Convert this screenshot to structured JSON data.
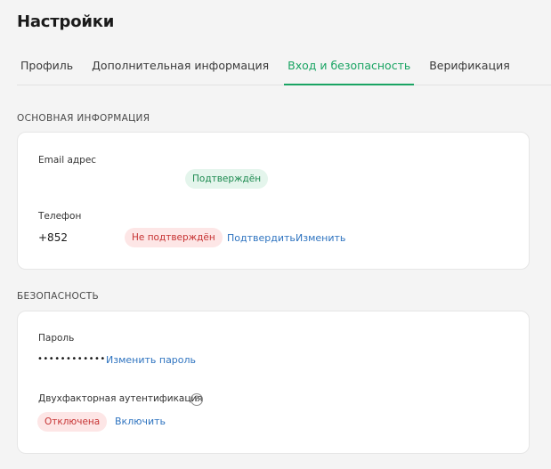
{
  "page": {
    "title": "Настройки"
  },
  "tabs": [
    {
      "label": "Профиль",
      "active": false
    },
    {
      "label": "Дополнительная информация",
      "active": false
    },
    {
      "label": "Вход и безопасность",
      "active": true
    },
    {
      "label": "Верификация",
      "active": false
    }
  ],
  "basic_info": {
    "section_title": "ОСНОВНАЯ ИНФОРМАЦИЯ",
    "email": {
      "label": "Email адрес",
      "status": "Подтверждён"
    },
    "phone": {
      "label": "Телефон",
      "value": "+852",
      "status": "Не подтверждён",
      "confirm_link": "Подтвердить",
      "change_link": "Изменить"
    }
  },
  "security": {
    "section_title": "БЕЗОПАСНОСТЬ",
    "password": {
      "label": "Пароль",
      "value": "••••••••••••",
      "change_link": "Изменить пароль"
    },
    "two_factor": {
      "label": "Двухфакторная аутентификация",
      "help_glyph": "?",
      "status": "Отключена",
      "enable_link": "Включить"
    }
  },
  "colors": {
    "accent": "#1aa463",
    "link": "#2f74c0",
    "ok_badge_bg": "#e4f5ec",
    "bad_badge_bg": "#fde6e6"
  }
}
